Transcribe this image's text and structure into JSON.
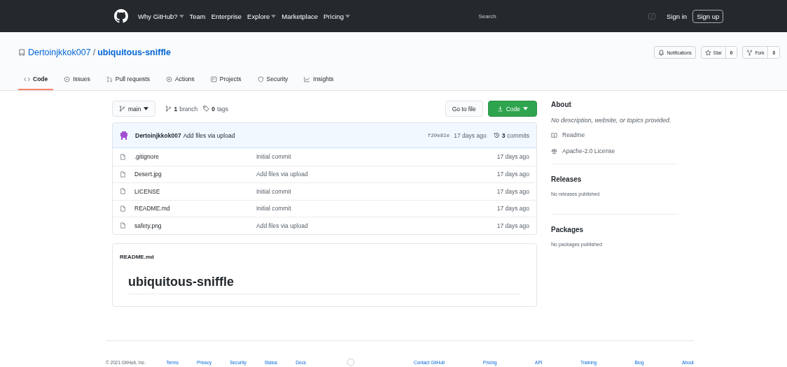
{
  "header": {
    "nav": [
      {
        "label": "Why GitHub?",
        "dropdown": true
      },
      {
        "label": "Team",
        "dropdown": false
      },
      {
        "label": "Enterprise",
        "dropdown": false
      },
      {
        "label": "Explore",
        "dropdown": true
      },
      {
        "label": "Marketplace",
        "dropdown": false
      },
      {
        "label": "Pricing",
        "dropdown": true
      }
    ],
    "search": {
      "placeholder": "Search"
    },
    "search_key": "/",
    "sign_in": "Sign in",
    "sign_up": "Sign up"
  },
  "repo": {
    "owner": "Dertoinjkkok007",
    "separator": "/",
    "name": "ubiquitous-sniffle",
    "actions": [
      {
        "label": "Notifications"
      },
      {
        "label": "Star",
        "count": "0"
      },
      {
        "label": "Fork",
        "count": "0"
      }
    ]
  },
  "tabs": [
    {
      "label": "Code",
      "selected": true
    },
    {
      "label": "Issues",
      "selected": false
    },
    {
      "label": "Pull requests",
      "selected": false
    },
    {
      "label": "Actions",
      "selected": false
    },
    {
      "label": "Projects",
      "selected": false
    },
    {
      "label": "Security",
      "selected": false
    },
    {
      "label": "Insights",
      "selected": false
    }
  ],
  "toolbar": {
    "branch": "main",
    "branches_count": "1",
    "branches_label": "branch",
    "tags_count": "0",
    "tags_label": "tags",
    "go_to_file": "Go to file",
    "code_button": "Code"
  },
  "latest_commit": {
    "author": "Dertoinjkkok007",
    "message": "Add files via upload",
    "sha": "f20e81e",
    "time": "17 days ago",
    "commits_count": "3",
    "commits_label": "commits"
  },
  "files": [
    {
      "name": ".gitignore",
      "message": "Initial commit",
      "time": "17 days ago"
    },
    {
      "name": "Desert.jpg",
      "message": "Add files via upload",
      "time": "17 days ago"
    },
    {
      "name": "LICENSE",
      "message": "Initial commit",
      "time": "17 days ago"
    },
    {
      "name": "README.md",
      "message": "Initial commit",
      "time": "17 days ago"
    },
    {
      "name": "safety.png",
      "message": "Add files via upload",
      "time": "17 days ago"
    }
  ],
  "readme": {
    "filename": "README.md",
    "heading": "ubiquitous-sniffle"
  },
  "sidebar": {
    "about_title": "About",
    "description": "No description, website, or topics provided.",
    "links": [
      {
        "label": "Readme"
      },
      {
        "label": "Apache-2.0 License"
      }
    ],
    "sections": [
      {
        "title": "Releases",
        "text": "No releases published"
      },
      {
        "title": "Packages",
        "text": "No packages published"
      }
    ]
  },
  "footer": {
    "copyright": "© 2021 GitHub, Inc.",
    "left_links": [
      "Terms",
      "Privacy",
      "Security",
      "Status",
      "Docs"
    ],
    "right_links": [
      "Contact GitHub",
      "Pricing",
      "API",
      "Training",
      "Blog",
      "About"
    ]
  }
}
